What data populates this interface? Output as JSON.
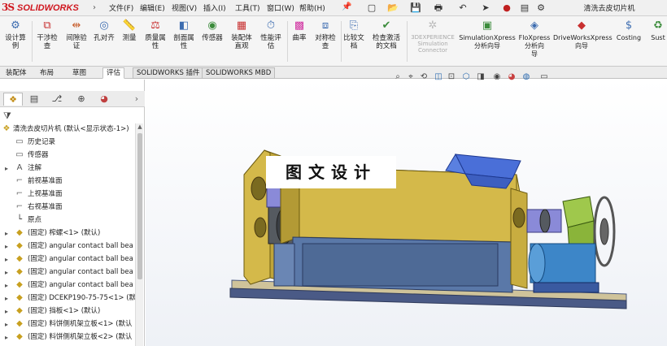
{
  "app": {
    "logo_ds": "3S",
    "logo_name": "SOLIDWORKS",
    "document_title": "清洗去皮切片机"
  },
  "menu": [
    "文件(F)",
    "编辑(E)",
    "视图(V)",
    "插入(I)",
    "工具(T)",
    "窗口(W)",
    "帮助(H)"
  ],
  "quick_access_icons": [
    "new-document-icon",
    "open-icon",
    "save-icon",
    "print-icon",
    "undo-icon",
    "select-icon",
    "rebuild-traffic-light-icon",
    "file-properties-icon",
    "options-gear-icon"
  ],
  "commands": [
    {
      "label": "设计算\n例",
      "icon": "design-study-icon",
      "disabled": false
    },
    {
      "label": "干涉检\n查",
      "icon": "interference-check-icon",
      "disabled": false
    },
    {
      "label": "间隙验\n证",
      "icon": "clearance-verification-icon",
      "disabled": false
    },
    {
      "label": "孔对齐",
      "icon": "hole-alignment-icon",
      "disabled": false
    },
    {
      "label": "测量",
      "icon": "measure-icon",
      "disabled": false
    },
    {
      "label": "质量属\n性",
      "icon": "mass-properties-icon",
      "disabled": false
    },
    {
      "label": "剖面属\n性",
      "icon": "section-properties-icon",
      "disabled": false
    },
    {
      "label": "传感器",
      "icon": "sensor-icon",
      "disabled": false
    },
    {
      "label": "装配体\n直观",
      "icon": "assembly-visualization-icon",
      "disabled": false
    },
    {
      "label": "性能评\n估",
      "icon": "performance-evaluation-icon",
      "disabled": false
    },
    {
      "label": "曲率",
      "icon": "curvature-icon",
      "disabled": false
    },
    {
      "label": "对称检\n查",
      "icon": "symmetry-check-icon",
      "disabled": false
    },
    {
      "label": "比较文\n档",
      "icon": "compare-documents-icon",
      "disabled": false
    },
    {
      "label": "检查激活\n的文档",
      "icon": "check-active-document-icon",
      "disabled": false
    },
    {
      "label": "3DEXPERIENCE\nSimulation\nConnector",
      "icon": "3dexperience-icon",
      "disabled": true
    },
    {
      "label": "SimulationXpress\n分析向导",
      "icon": "simulationxpress-icon",
      "disabled": false
    },
    {
      "label": "FloXpress\n分析向\n导",
      "icon": "floxpress-icon",
      "disabled": false
    },
    {
      "label": "DriveWorksXpress\n向导",
      "icon": "driveworksxpress-icon",
      "disabled": false
    },
    {
      "label": "Costing",
      "icon": "costing-icon",
      "disabled": false
    },
    {
      "label": "Sust",
      "icon": "sustainability-icon",
      "disabled": false
    }
  ],
  "tabs": [
    {
      "label": "装配体",
      "active": false,
      "boxed": false
    },
    {
      "label": "布局",
      "active": false,
      "boxed": false
    },
    {
      "label": "草图",
      "active": false,
      "boxed": false
    },
    {
      "label": "评估",
      "active": true,
      "boxed": false
    },
    {
      "label": "SOLIDWORKS 插件",
      "active": false,
      "boxed": true
    },
    {
      "label": "SOLIDWORKS MBD",
      "active": false,
      "boxed": true
    }
  ],
  "feature_manager": {
    "tab_icons": [
      "feature-tree-icon",
      "property-manager-icon",
      "configuration-manager-icon",
      "dimxpert-icon",
      "display-manager-icon"
    ],
    "root": "清洗去皮切片机  (默认<显示状态-1>)",
    "items": [
      {
        "label": "历史记录",
        "icon": "history-folder-icon",
        "expand": ""
      },
      {
        "label": "传感器",
        "icon": "sensor-folder-icon",
        "expand": ""
      },
      {
        "label": "注解",
        "icon": "annotations-icon",
        "expand": "▸"
      },
      {
        "label": "前视基准面",
        "icon": "plane-icon",
        "expand": ""
      },
      {
        "label": "上视基准面",
        "icon": "plane-icon",
        "expand": ""
      },
      {
        "label": "右视基准面",
        "icon": "plane-icon",
        "expand": ""
      },
      {
        "label": "原点",
        "icon": "origin-icon",
        "expand": ""
      },
      {
        "label": "(固定) 榨螺<1> (默认)",
        "icon": "part-icon",
        "expand": "▸"
      },
      {
        "label": "(固定) angular contact ball bea",
        "icon": "part-icon",
        "expand": "▸"
      },
      {
        "label": "(固定) angular contact ball bea",
        "icon": "part-icon",
        "expand": "▸"
      },
      {
        "label": "(固定) angular contact ball bea",
        "icon": "part-icon",
        "expand": "▸"
      },
      {
        "label": "(固定) angular contact ball bea",
        "icon": "part-icon",
        "expand": "▸"
      },
      {
        "label": "(固定) DCEKP190-75-75<1> (默",
        "icon": "part-icon",
        "expand": "▸"
      },
      {
        "label": "(固定) 挡板<1> (默认)",
        "icon": "part-icon",
        "expand": "▸"
      },
      {
        "label": "(固定) 料饼侧机架立板<1> (默认",
        "icon": "part-icon",
        "expand": "▸"
      },
      {
        "label": "(固定) 料饼侧机架立板<2> (默认",
        "icon": "part-icon",
        "expand": "▸"
      }
    ]
  },
  "viewport": {
    "hud_icons": [
      "zoom-to-fit-icon",
      "zoom-area-icon",
      "previous-view-icon",
      "section-view-icon",
      "dynamic-annotation-icon",
      "view-orientation-icon",
      "display-style-icon",
      "hide-show-icon",
      "edit-appearance-icon",
      "apply-scene-icon",
      "view-settings-icon"
    ],
    "watermark": "图文设计"
  },
  "colors": {
    "frame": "#d4b94a",
    "frame_dark": "#a68d28",
    "base": "#5a78a8",
    "hopper": "#4a6fd8",
    "motor": "#3d86c8",
    "gearbox": "#9fc84c",
    "roller": "#8a8ad8"
  }
}
